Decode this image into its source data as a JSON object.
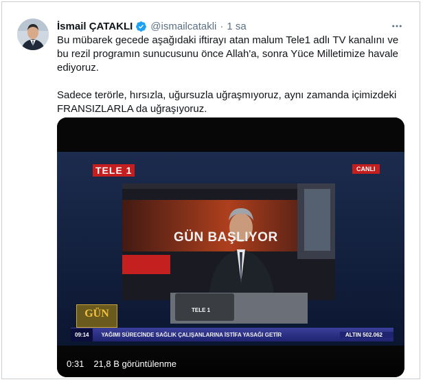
{
  "tweet": {
    "author": {
      "display_name": "İsmail ÇATAKLI",
      "handle": "@ismailcatakli",
      "verified_icon": "verified-badge-icon",
      "verified_color": "#1da1f2"
    },
    "separator": "·",
    "time": "1 sa",
    "more_icon": "more-dots-icon",
    "text": {
      "paragraph_1": "Bu mübarek gecede aşağıdaki iftirayı atan malum Tele1 adlı TV kanalını ve bu rezil programın sunucusunu önce Allah'a, sonra Yüce Milletimize havale ediyoruz.",
      "paragraph_2": "Sadece terörle, hırsızla, uğursuzla uğraşmıyoruz, aynı zamanda içimizdeki FRANSIZLARLA da uğraşıyoruz."
    },
    "video": {
      "channel_logo": "TELE 1",
      "live_badge": "CANLI",
      "show_title": "GÜN BAŞLIYOR",
      "desk_logo": "TELE 1",
      "corner_logo": "GÜN",
      "ticker_time": "09:14",
      "ticker_text": "YAĞIMI SÜRECİNDE SAĞLIK ÇALIŞANLARINA İSTİFA YASAĞI GETİR",
      "ticker_right": "ALTIN 502.062",
      "duration": "0:31",
      "views": "21,8 B görüntülenme"
    }
  }
}
